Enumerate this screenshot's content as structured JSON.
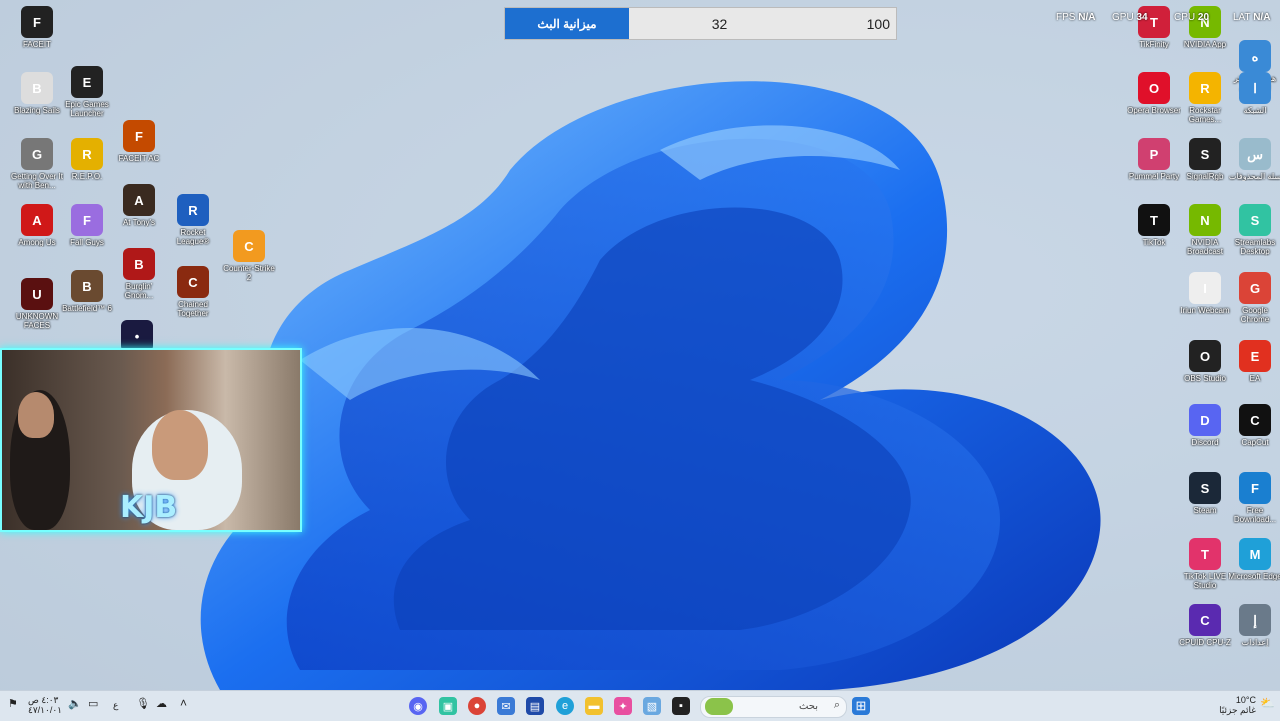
{
  "overlay": {
    "stats": [
      {
        "label": "FPS",
        "value": "N/A"
      },
      {
        "label": "GPU",
        "value": "34"
      },
      {
        "label": "CPU",
        "value": "20"
      },
      {
        "label": "LAT",
        "value": "N/A"
      }
    ],
    "budget": {
      "title": "ميزانية البث",
      "current": "32",
      "max": "100"
    },
    "cam_logo": "KJB"
  },
  "desktop": {
    "icons_left": [
      {
        "label": "FACEIT",
        "icon": "faceit-icon",
        "color": "#222"
      },
      {
        "label": "Blazing Sails",
        "icon": "skull-icon",
        "color": "#ddd"
      },
      {
        "label": "Epic Games Launcher",
        "icon": "epic-icon",
        "color": "#222"
      },
      {
        "label": "Getting Over It with Ben...",
        "icon": "hammer-icon",
        "color": "#777"
      },
      {
        "label": "R.E.P.O.",
        "icon": "repo-icon",
        "color": "#e4b000"
      },
      {
        "label": "FACEIT AC",
        "icon": "faceit-ac-icon",
        "color": "#c44a00"
      },
      {
        "label": "Among Us",
        "icon": "among-us-icon",
        "color": "#d01818"
      },
      {
        "label": "Fall Guys",
        "icon": "fall-guys-icon",
        "color": "#9a6de0"
      },
      {
        "label": "At Tony's",
        "icon": "face-icon",
        "color": "#3a2a20"
      },
      {
        "label": "Rocket League®",
        "icon": "rocket-icon",
        "color": "#1e5fbf"
      },
      {
        "label": "Counter-Strike 2",
        "icon": "cs2-icon",
        "color": "#f29a1f"
      },
      {
        "label": "UNKNOWN FACES",
        "icon": "hat-icon",
        "color": "#5a1010"
      },
      {
        "label": "Battlefield™ 6",
        "icon": "battlefield-icon",
        "color": "#6a4a30"
      },
      {
        "label": "Burglin' Gnom...",
        "icon": "gnome-icon",
        "color": "#b01818"
      },
      {
        "label": "Chained Together",
        "icon": "chain-icon",
        "color": "#8a2a10"
      },
      {
        "label": "",
        "icon": "app-icon",
        "color": "#1a1a40"
      }
    ],
    "icons_right": [
      {
        "label": "TikFinity",
        "icon": "tikfinity-icon",
        "color": "#d0203a"
      },
      {
        "label": "NVIDIA App",
        "icon": "nvidia-icon",
        "color": "#76b900"
      },
      {
        "label": "هذا الكمبيوتر الشخصي",
        "icon": "pc-icon",
        "color": "#3a8ad6"
      },
      {
        "label": "Opera Browser",
        "icon": "opera-icon",
        "color": "#e0102a"
      },
      {
        "label": "Rockstar Games...",
        "icon": "rockstar-icon",
        "color": "#f4b400"
      },
      {
        "label": "الشبكة",
        "icon": "network-icon",
        "color": "#3a8ad6"
      },
      {
        "label": "Pummel Party",
        "icon": "pummel-icon",
        "color": "#d04070"
      },
      {
        "label": "SignalRgb",
        "icon": "signalrgb-icon",
        "color": "#222"
      },
      {
        "label": "سلة المحذوفات",
        "icon": "recycle-bin-icon",
        "color": "#9bc"
      },
      {
        "label": "TikTok",
        "icon": "tiktok-icon",
        "color": "#111"
      },
      {
        "label": "NVIDIA Broadcast",
        "icon": "nvidia-broadcast-icon",
        "color": "#76b900"
      },
      {
        "label": "Streamlabs Desktop",
        "icon": "streamlabs-icon",
        "color": "#31c3a2"
      },
      {
        "label": "Iriun Webcam",
        "icon": "file-icon",
        "color": "#eee"
      },
      {
        "label": "Google Chrome",
        "icon": "chrome-icon",
        "color": "#db4437"
      },
      {
        "label": "OBS Studio",
        "icon": "obs-icon",
        "color": "#222"
      },
      {
        "label": "EA",
        "icon": "ea-icon",
        "color": "#e1301f"
      },
      {
        "label": "Discord",
        "icon": "discord-icon",
        "color": "#5865f2"
      },
      {
        "label": "CapCut",
        "icon": "capcut-icon",
        "color": "#111"
      },
      {
        "label": "Steam",
        "icon": "steam-icon",
        "color": "#1b2838"
      },
      {
        "label": "Free Download...",
        "icon": "download-icon",
        "color": "#1a7fd0"
      },
      {
        "label": "TikTok LIVE Studio",
        "icon": "tiktok-live-icon",
        "color": "#e2336b"
      },
      {
        "label": "Microsoft Edge",
        "icon": "edge-icon",
        "color": "#1fa0d8"
      },
      {
        "label": "CPUID CPU-Z",
        "icon": "cpuz-icon",
        "color": "#5a2ab0"
      },
      {
        "label": "إعدادات",
        "icon": "settings-icon",
        "color": "#6a7a8a"
      }
    ]
  },
  "taskbar": {
    "time": "٤:٠٣ ص",
    "date": "٤٧/١٠/٠١",
    "lang": "ع",
    "search_placeholder": "بحث",
    "weather_temp": "10°C",
    "weather_label": "غائم جزئيًا"
  }
}
